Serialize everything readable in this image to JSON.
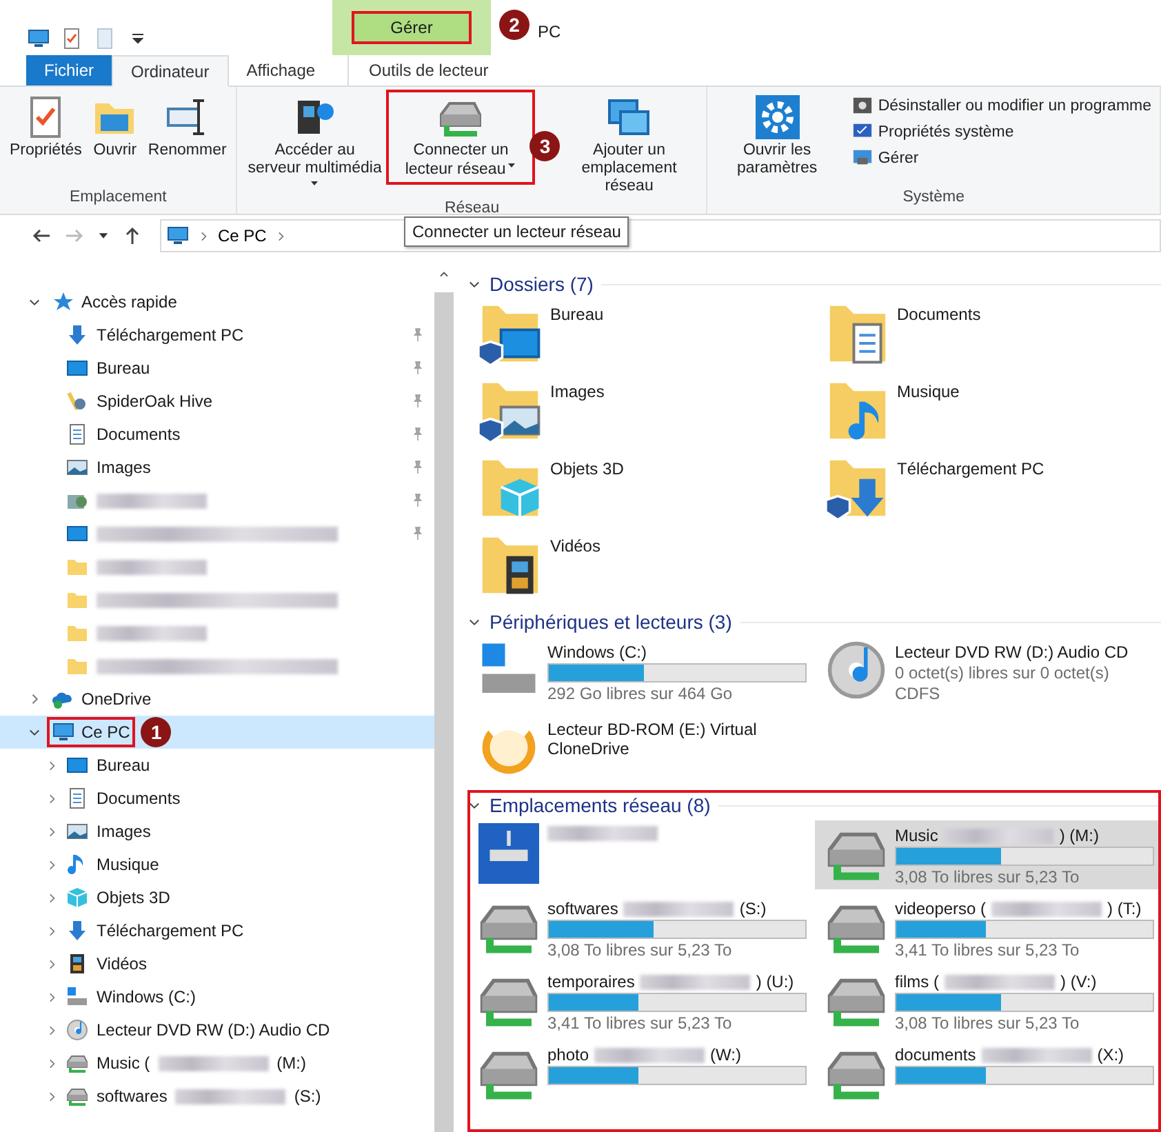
{
  "window": {
    "title": "PC"
  },
  "quick_toolbar": [
    {
      "kind": "computer"
    },
    {
      "kind": "properties"
    },
    {
      "kind": "newfolder"
    },
    {
      "kind": "dropdown"
    }
  ],
  "context_header": {
    "label": "Gérer",
    "highlighted": true,
    "callout": "2"
  },
  "tabs": [
    {
      "label": "Fichier",
      "kind": "file",
      "selected": false
    },
    {
      "label": "Ordinateur",
      "kind": "normal",
      "selected": true
    },
    {
      "label": "Affichage",
      "kind": "normal",
      "selected": false
    },
    {
      "label": "Outils de lecteur",
      "kind": "context",
      "selected": false
    }
  ],
  "ribbon_groups": [
    {
      "title": "Emplacement",
      "buttons": [
        {
          "label": "Propriétés",
          "kind": "properties",
          "dropdown": false,
          "highlighted": false
        },
        {
          "label": "Ouvrir",
          "kind": "open",
          "dropdown": false,
          "highlighted": false
        },
        {
          "label": "Renommer",
          "kind": "rename",
          "dropdown": false,
          "highlighted": false
        }
      ]
    },
    {
      "title": "Réseau",
      "buttons": [
        {
          "label": "Accéder au serveur multimédia",
          "kind": "media",
          "dropdown": true,
          "highlighted": false
        },
        {
          "label": "Connecter un lecteur réseau",
          "kind": "netdrive",
          "dropdown": true,
          "highlighted": true,
          "callout": "3"
        },
        {
          "label": "Ajouter un emplacement réseau",
          "kind": "netplace",
          "dropdown": false,
          "highlighted": false
        }
      ]
    },
    {
      "title": "Système",
      "buttons": [
        {
          "label": "Ouvrir les paramètres",
          "kind": "settings",
          "dropdown": false,
          "highlighted": false
        }
      ],
      "small_buttons": [
        {
          "label": "Désinstaller ou modifier un programme",
          "kind": "uninstall"
        },
        {
          "label": "Propriétés système",
          "kind": "sysprops"
        },
        {
          "label": "Gérer",
          "kind": "manage"
        }
      ]
    }
  ],
  "tooltip": "Connecter un lecteur réseau",
  "address_bar": {
    "path": [
      "Ce PC"
    ]
  },
  "navigation": [
    {
      "label": "Accès rapide",
      "kind": "star",
      "expanded": true,
      "selected": false,
      "highlighted": false,
      "children": [
        {
          "label": "Téléchargement PC",
          "kind": "download",
          "pinned": true
        },
        {
          "label": "Bureau",
          "kind": "desktop",
          "pinned": true
        },
        {
          "label": "SpiderOak Hive",
          "kind": "spideroak",
          "pinned": true
        },
        {
          "label": "Documents",
          "kind": "documents",
          "pinned": true
        },
        {
          "label": "Images",
          "kind": "pictures",
          "pinned": true
        },
        {
          "kind": "netfolder",
          "redacted": true,
          "pinned": true
        },
        {
          "kind": "desktop",
          "redacted": true,
          "pinned": true
        },
        {
          "kind": "folder",
          "redacted": true,
          "pinned": false
        },
        {
          "kind": "folder",
          "redacted": true,
          "pinned": false
        },
        {
          "kind": "folder",
          "redacted": true,
          "pinned": false
        },
        {
          "kind": "folder",
          "redacted": true,
          "pinned": false
        }
      ]
    },
    {
      "label": "OneDrive",
      "kind": "onedrive",
      "expanded": false,
      "selected": false,
      "highlighted": false
    },
    {
      "label": "Ce PC",
      "kind": "computer",
      "expanded": true,
      "selected": true,
      "highlighted": true,
      "callout": "1",
      "children": [
        {
          "label": "Bureau",
          "kind": "desktop",
          "expanded": false
        },
        {
          "label": "Documents",
          "kind": "documents",
          "expanded": false
        },
        {
          "label": "Images",
          "kind": "pictures",
          "expanded": false
        },
        {
          "label": "Musique",
          "kind": "music",
          "expanded": false
        },
        {
          "label": "Objets 3D",
          "kind": "objects3d",
          "expanded": false
        },
        {
          "label": "Téléchargement PC",
          "kind": "download",
          "expanded": false
        },
        {
          "label": "Vidéos",
          "kind": "videos",
          "expanded": false
        },
        {
          "label": "Windows (C:)",
          "kind": "windrive",
          "expanded": false
        },
        {
          "label": "Lecteur DVD RW (D:) Audio CD",
          "kind": "dvd",
          "expanded": false
        },
        {
          "label": "Music (",
          "suffix": "(M:)",
          "redacted": true,
          "kind": "netdrive",
          "expanded": false
        },
        {
          "label": "softwares",
          "suffix": "(S:)",
          "redacted": true,
          "kind": "netdrive",
          "expanded": false
        }
      ]
    }
  ],
  "sections": [
    {
      "title": "Dossiers (7)",
      "expanded": true,
      "items": [
        {
          "label": "Bureau",
          "kind": "desktop",
          "shared": true
        },
        {
          "label": "Documents",
          "kind": "documents",
          "shared": false
        },
        {
          "label": "Images",
          "kind": "pictures",
          "shared": true
        },
        {
          "label": "Musique",
          "kind": "music",
          "shared": false
        },
        {
          "label": "Objets 3D",
          "kind": "objects3d",
          "shared": false
        },
        {
          "label": "Téléchargement PC",
          "kind": "download",
          "shared": true
        },
        {
          "label": "Vidéos",
          "kind": "videos",
          "shared": false
        }
      ]
    },
    {
      "title": "Périphériques et lecteurs (3)",
      "expanded": true,
      "items": [
        {
          "label": "Windows (C:)",
          "kind": "windrive",
          "level": 0.37,
          "lines": [
            "292 Go libres sur 464 Go"
          ]
        },
        {
          "label": "Lecteur DVD RW (D:) Audio CD",
          "kind": "dvd",
          "lines": [
            "0 octet(s) libres sur 0 octet(s)",
            "CDFS"
          ]
        },
        {
          "label": "Lecteur BD-ROM (E:) Virtual CloneDrive",
          "kind": "clonedrive"
        }
      ]
    },
    {
      "title": "Emplacements réseau (8)",
      "expanded": true,
      "highlighted": true,
      "items": [
        {
          "kind": "nas",
          "redacted": true,
          "selected": false
        },
        {
          "label": "Music",
          "suffix": ") (M:)",
          "redacted": true,
          "kind": "netdrive",
          "level": 0.41,
          "lines": [
            "3,08 To libres sur 5,23 To"
          ],
          "selected": true
        },
        {
          "label": "softwares",
          "suffix": "(S:)",
          "redacted": true,
          "kind": "netdrive",
          "level": 0.41,
          "lines": [
            "3,08 To libres sur 5,23 To"
          ],
          "selected": false
        },
        {
          "label": "videoperso (",
          "suffix": ") (T:)",
          "redacted": true,
          "kind": "netdrive",
          "level": 0.35,
          "lines": [
            "3,41 To libres sur 5,23 To"
          ],
          "selected": false
        },
        {
          "label": "temporaires",
          "suffix": ") (U:)",
          "redacted": true,
          "kind": "netdrive",
          "level": 0.35,
          "lines": [
            "3,41 To libres sur 5,23 To"
          ],
          "selected": false
        },
        {
          "label": "films (",
          "suffix": ") (V:)",
          "redacted": true,
          "kind": "netdrive",
          "level": 0.41,
          "lines": [
            "3,08 To libres sur 5,23 To"
          ],
          "selected": false
        },
        {
          "label": "photo",
          "suffix": "(W:)",
          "redacted": true,
          "kind": "netdrive",
          "level": 0.35,
          "selected": false
        },
        {
          "label": "documents",
          "suffix": "(X:)",
          "redacted": true,
          "kind": "netdrive",
          "level": 0.35,
          "selected": false
        }
      ]
    }
  ]
}
